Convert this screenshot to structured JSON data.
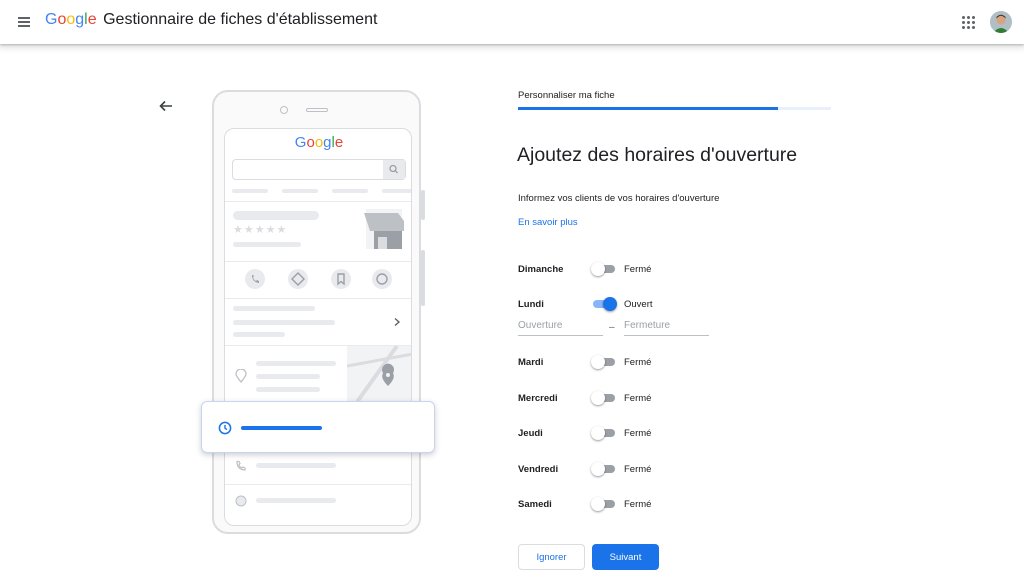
{
  "header": {
    "logo_letters": [
      {
        "char": "G",
        "color": "#4285F4"
      },
      {
        "char": "o",
        "color": "#EA4335"
      },
      {
        "char": "o",
        "color": "#FBBC05"
      },
      {
        "char": "g",
        "color": "#4285F4"
      },
      {
        "char": "l",
        "color": "#34A853"
      },
      {
        "char": "e",
        "color": "#EA4335"
      }
    ],
    "title": "Gestionnaire de fiches d'établissement",
    "menu_icon": "hamburger-menu-icon",
    "apps_icon": "apps-grid-icon",
    "avatar_icon": "user-avatar"
  },
  "illustration": {
    "logo_text": "Google"
  },
  "form": {
    "step_label": "Personnaliser ma fiche",
    "progress": 0.83,
    "heading": "Ajoutez des horaires d'ouverture",
    "intro": "Informez vos clients de vos horaires d'ouverture",
    "learn_more": "En savoir plus",
    "days": [
      {
        "name": "Dimanche",
        "open": false,
        "status": "Fermé"
      },
      {
        "name": "Lundi",
        "open": true,
        "status": "Ouvert"
      },
      {
        "name": "Mardi",
        "open": false,
        "status": "Fermé"
      },
      {
        "name": "Mercredi",
        "open": false,
        "status": "Fermé"
      },
      {
        "name": "Jeudi",
        "open": false,
        "status": "Fermé"
      },
      {
        "name": "Vendredi",
        "open": false,
        "status": "Fermé"
      },
      {
        "name": "Samedi",
        "open": false,
        "status": "Fermé"
      }
    ],
    "open_placeholder": "Ouverture",
    "close_placeholder": "Fermeture",
    "ignore_label": "Ignorer",
    "next_label": "Suivant"
  },
  "colors": {
    "accent": "#1a73e8",
    "toggle_on_track": "#8ab4f8",
    "toggle_off_track": "#9aa0a6"
  }
}
